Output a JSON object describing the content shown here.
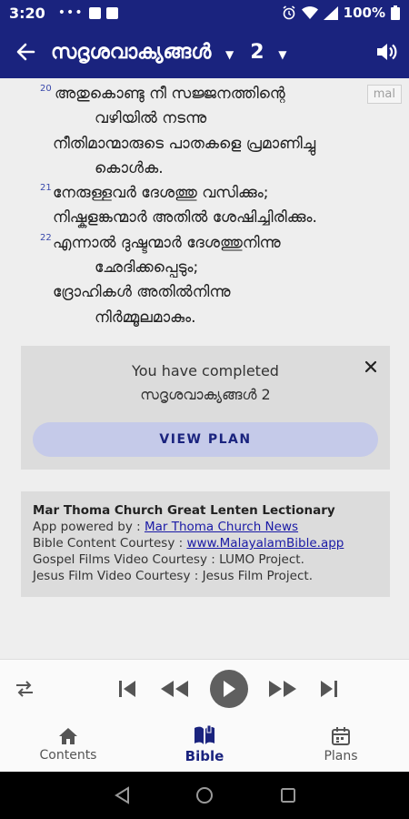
{
  "status_bar": {
    "time": "3:20",
    "battery": "100%"
  },
  "app_bar": {
    "book_title": "സദൃശവാക്യങ്ങൾ",
    "chapter": "2"
  },
  "reader": {
    "language_badge": "mal",
    "verses": [
      {
        "num": "20",
        "lines": [
          "അതുകൊണ്ടു നീ സജ്ജനത്തിന്റെ",
          "വഴിയിൽ നടന്നു",
          "നീതിമാന്മാരുടെ പാതകളെ പ്രമാണിച്ചു",
          "കൊൾക."
        ]
      },
      {
        "num": "21",
        "lines": [
          "നേരുള്ളവർ ദേശത്തു വസിക്കും;",
          "നിഷ്കളങ്കന്മാർ അതിൽ ശേഷിച്ചിരിക്കും."
        ]
      },
      {
        "num": "22",
        "lines": [
          "എന്നാൽ ദുഷ്ടന്മാർ ദേശത്തുനിന്നു",
          "ഛേദിക്കപ്പെടും;",
          "ദ്രോഹികൾ അതിൽനിന്നു",
          "നിർമ്മൂലമാകും."
        ]
      }
    ]
  },
  "plan_card": {
    "message_line1": "You have completed",
    "message_line2": "സദൃശവാക്യങ്ങൾ 2",
    "button_label": "VIEW PLAN"
  },
  "credits": {
    "heading": "Mar Thoma Church Great Lenten Lectionary",
    "powered_prefix": "App powered by : ",
    "powered_link": "Mar Thoma Church News",
    "bible_prefix": "Bible Content Courtesy : ",
    "bible_link": "www.MalayalamBible.app",
    "gospel_line": "Gospel Films Video Courtesy : LUMO Project.",
    "jesus_line": "Jesus Film Video Courtesy : Jesus Film Project."
  },
  "bottom_nav": {
    "contents": "Contents",
    "bible": "Bible",
    "plans": "Plans"
  },
  "colors": {
    "primary": "#1a237e",
    "accent_light": "#c5cae9",
    "card_bg": "#dcdcdc",
    "link": "#1a1aa6"
  }
}
